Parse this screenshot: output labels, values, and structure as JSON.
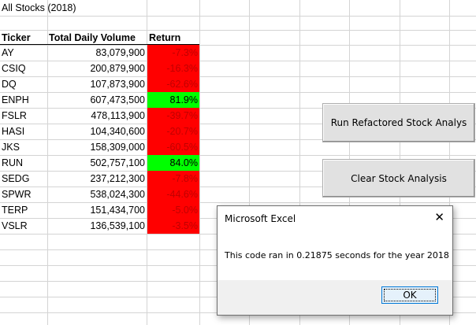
{
  "sheet": {
    "title": "All Stocks (2018)",
    "headers": {
      "ticker": "Ticker",
      "volume": "Total Daily Volume",
      "return": "Return"
    },
    "rows": [
      {
        "ticker": "AY",
        "volume": "83,079,900",
        "return": "-7.3%",
        "positive": false
      },
      {
        "ticker": "CSIQ",
        "volume": "200,879,900",
        "return": "-16.3%",
        "positive": false
      },
      {
        "ticker": "DQ",
        "volume": "107,873,900",
        "return": "-62.6%",
        "positive": false
      },
      {
        "ticker": "ENPH",
        "volume": "607,473,500",
        "return": "81.9%",
        "positive": true
      },
      {
        "ticker": "FSLR",
        "volume": "478,113,900",
        "return": "-39.7%",
        "positive": false
      },
      {
        "ticker": "HASI",
        "volume": "104,340,600",
        "return": "-20.7%",
        "positive": false
      },
      {
        "ticker": "JKS",
        "volume": "158,309,000",
        "return": "-60.5%",
        "positive": false
      },
      {
        "ticker": "RUN",
        "volume": "502,757,100",
        "return": "84.0%",
        "positive": true
      },
      {
        "ticker": "SEDG",
        "volume": "237,212,300",
        "return": "-7.8%",
        "positive": false
      },
      {
        "ticker": "SPWR",
        "volume": "538,024,300",
        "return": "-44.6%",
        "positive": false
      },
      {
        "ticker": "TERP",
        "volume": "151,434,700",
        "return": "-5.0%",
        "positive": false
      },
      {
        "ticker": "VSLR",
        "volume": "136,539,100",
        "return": "-3.5%",
        "positive": false
      }
    ],
    "colors": {
      "negative": "#ff0000",
      "positive": "#00ff00"
    }
  },
  "buttons": {
    "run_label": "Run Refactored Stock Analys",
    "clear_label": "Clear Stock Analysis"
  },
  "dialog": {
    "title": "Microsoft Excel",
    "close_icon": "close-icon",
    "message": "This code ran in 0.21875 seconds for the year 2018",
    "ok_label": "OK"
  }
}
